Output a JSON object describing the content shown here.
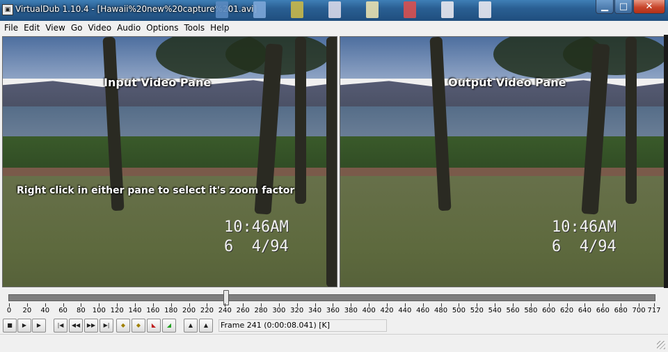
{
  "window": {
    "title": "VirtualDub 1.10.4 - [Hawaii%20new%20capture%201.avi]",
    "app_icon": "virtualdub-icon",
    "buttons": {
      "minimize": "minimize-icon",
      "maximize": "maximize-icon",
      "close": "close-icon"
    }
  },
  "menu": [
    "File",
    "Edit",
    "View",
    "Go",
    "Video",
    "Audio",
    "Options",
    "Tools",
    "Help"
  ],
  "panes": {
    "input_label": "Input Video Pane",
    "output_label": "Output Video Pane",
    "hint": "Right click in either pane to select it's zoom factor",
    "stamp_time": "10:46AM",
    "stamp_date": "6  4/94"
  },
  "timeline": {
    "ticks": [
      "0",
      "20",
      "40",
      "60",
      "80",
      "100",
      "120",
      "140",
      "160",
      "180",
      "200",
      "220",
      "240",
      "260",
      "280",
      "300",
      "320",
      "340",
      "360",
      "380",
      "400",
      "420",
      "440",
      "460",
      "480",
      "500",
      "520",
      "540",
      "560",
      "580",
      "600",
      "620",
      "640",
      "660",
      "680",
      "700",
      "717"
    ],
    "min": 0,
    "max": 717,
    "current_frame": 241
  },
  "toolbar": {
    "buttons": [
      {
        "name": "stop-button",
        "icon": "stop-icon"
      },
      {
        "name": "play-input-button",
        "icon": "play-input-icon"
      },
      {
        "name": "play-output-button",
        "icon": "play-output-icon"
      },
      {
        "name": "go-start-button",
        "icon": "skip-start-icon"
      },
      {
        "name": "back-button",
        "icon": "rewind-icon"
      },
      {
        "name": "forward-button",
        "icon": "fast-forward-icon"
      },
      {
        "name": "go-end-button",
        "icon": "skip-end-icon"
      },
      {
        "name": "prev-keyframe-button",
        "icon": "prev-keyframe-icon"
      },
      {
        "name": "next-keyframe-button",
        "icon": "next-keyframe-icon"
      },
      {
        "name": "prev-scene-button",
        "icon": "prev-scene-icon"
      },
      {
        "name": "next-scene-button",
        "icon": "next-scene-icon"
      },
      {
        "name": "mark-in-button",
        "icon": "mark-in-icon"
      },
      {
        "name": "mark-out-button",
        "icon": "mark-out-icon"
      }
    ],
    "frame_info": "Frame 241 (0:00:08.041) [K]"
  }
}
